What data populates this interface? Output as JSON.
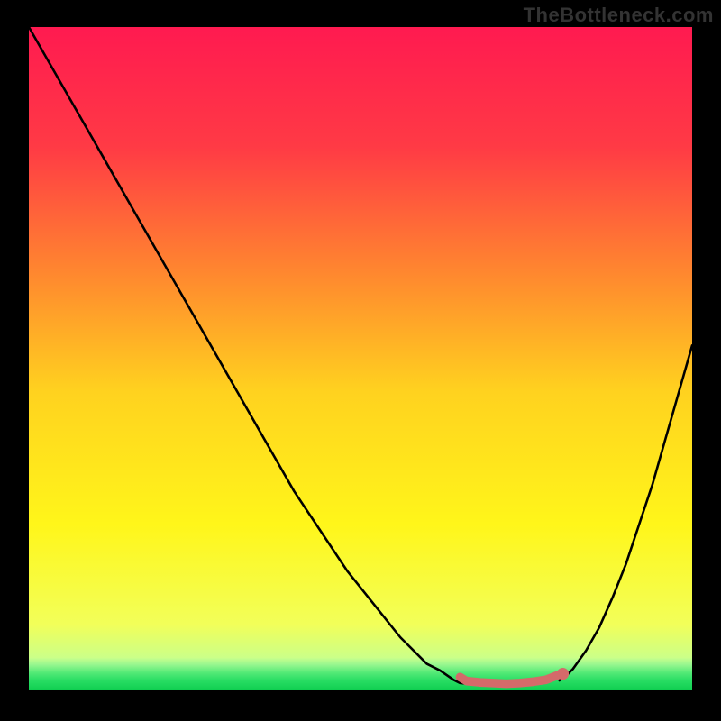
{
  "watermark": "TheBottleneck.com",
  "chart_data": {
    "type": "line",
    "title": "",
    "xlabel": "",
    "ylabel": "",
    "xlim": [
      0,
      100
    ],
    "ylim": [
      0,
      100
    ],
    "gradient_stops": [
      {
        "offset": 0.0,
        "color": "#ff1a50"
      },
      {
        "offset": 0.18,
        "color": "#ff3a45"
      },
      {
        "offset": 0.38,
        "color": "#ff8b2e"
      },
      {
        "offset": 0.55,
        "color": "#ffd21f"
      },
      {
        "offset": 0.75,
        "color": "#fff61a"
      },
      {
        "offset": 0.9,
        "color": "#f2ff59"
      },
      {
        "offset": 0.955,
        "color": "#c8ff8c"
      },
      {
        "offset": 1.0,
        "color": "#19e05b"
      }
    ],
    "green_band_stops": [
      {
        "offset": 0.0,
        "color": "#c8ff8c"
      },
      {
        "offset": 0.2,
        "color": "#99f78f"
      },
      {
        "offset": 0.45,
        "color": "#55ea77"
      },
      {
        "offset": 0.7,
        "color": "#28dd63"
      },
      {
        "offset": 1.0,
        "color": "#0fce50"
      }
    ],
    "series": [
      {
        "name": "left-branch",
        "x": [
          0,
          4,
          8,
          12,
          16,
          20,
          24,
          28,
          32,
          36,
          40,
          44,
          48,
          52,
          56,
          60,
          62,
          64,
          65,
          66
        ],
        "y": [
          100,
          93,
          86,
          79,
          72,
          65,
          58,
          51,
          44,
          37,
          30,
          24,
          18,
          13,
          8,
          4,
          3,
          1.6,
          1.1,
          1.0
        ]
      },
      {
        "name": "right-branch",
        "x": [
          80,
          81,
          82,
          84,
          86,
          88,
          90,
          92,
          94,
          96,
          98,
          100
        ],
        "y": [
          1.5,
          2.2,
          3.2,
          6.0,
          9.5,
          14,
          19,
          25,
          31,
          38,
          45,
          52
        ]
      }
    ],
    "bottom_segment": {
      "x": [
        65,
        66,
        68,
        70,
        72,
        74,
        76,
        78,
        79,
        80
      ],
      "y": [
        2.0,
        1.4,
        1.2,
        1.1,
        1.0,
        1.1,
        1.3,
        1.6,
        2.0,
        2.4
      ],
      "stroke": "#d46a6a",
      "stroke_width": 1.3
    },
    "bottom_dot": {
      "x": 80.5,
      "y": 2.5,
      "r": 0.9,
      "fill": "#d46a6a"
    }
  }
}
